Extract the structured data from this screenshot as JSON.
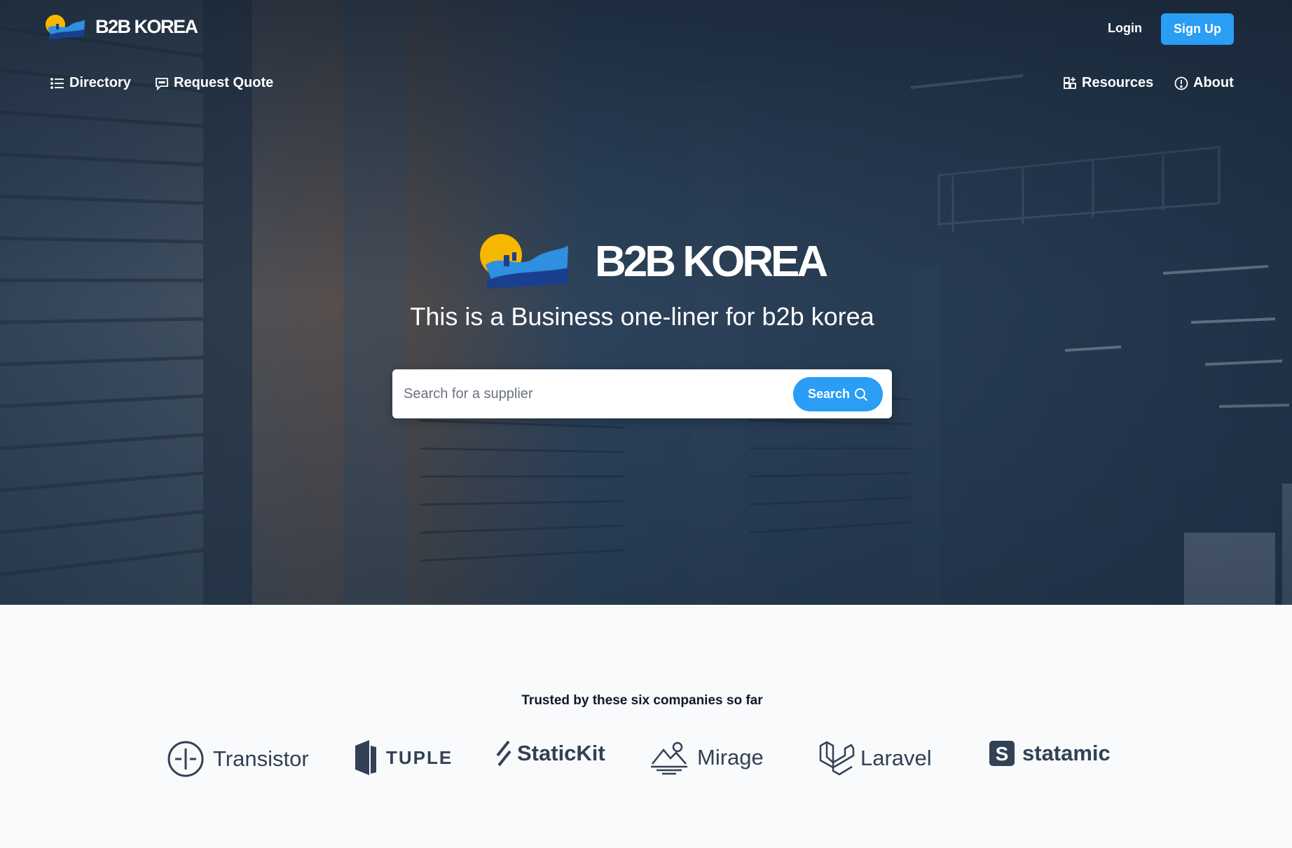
{
  "header": {
    "brand": "B2B KOREA",
    "login_label": "Login",
    "signup_label": "Sign Up"
  },
  "nav": {
    "left": [
      {
        "label": "Directory",
        "icon": "list-icon"
      },
      {
        "label": "Request Quote",
        "icon": "chat-icon"
      }
    ],
    "right": [
      {
        "label": "Resources",
        "icon": "grid-plus-icon"
      },
      {
        "label": "About",
        "icon": "info-circle-icon"
      }
    ]
  },
  "hero": {
    "brand": "B2B KOREA",
    "tagline": "This is a Business one-liner for b2b korea",
    "search_placeholder": "Search for a supplier",
    "search_button": "Search"
  },
  "trusted": {
    "title": "Trusted by these six companies so far",
    "logos": [
      {
        "name": "Transistor",
        "icon": "transistor-logo-icon"
      },
      {
        "name": "TUPLE",
        "icon": "tuple-logo-icon"
      },
      {
        "name": "StaticKit",
        "icon": "statickit-logo-icon"
      },
      {
        "name": "Mirage",
        "icon": "mirage-logo-icon"
      },
      {
        "name": "Laravel",
        "icon": "laravel-logo-icon"
      },
      {
        "name": "statamic",
        "icon": "statamic-logo-icon"
      }
    ]
  },
  "colors": {
    "accent": "#2a9df4",
    "logo_sun": "#f5b700",
    "logo_wave_light": "#2f8fe0",
    "logo_wave_dark": "#1b3f8f",
    "logo_text": "#334155"
  }
}
